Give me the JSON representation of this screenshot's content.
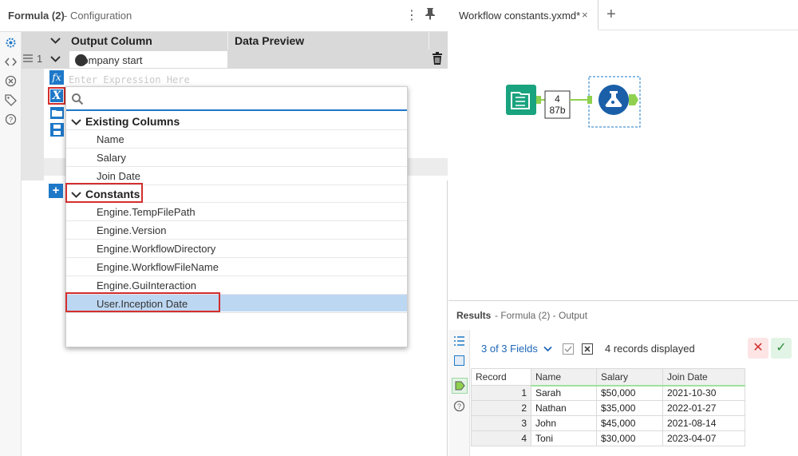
{
  "left_panel": {
    "title": "Formula (2)",
    "subtitle": "- Configuration"
  },
  "grid": {
    "col_output": "Output Column",
    "col_preview": "Data Preview",
    "row_number": "1",
    "output_value": "Company start",
    "expression_placeholder": "Enter Expression Here"
  },
  "popup": {
    "sections": [
      {
        "label": "Existing Columns",
        "items": [
          "Name",
          "Salary",
          "Join Date"
        ]
      },
      {
        "label": "Constants",
        "items": [
          "Engine.TempFilePath",
          "Engine.Version",
          "Engine.WorkflowDirectory",
          "Engine.WorkflowFileName",
          "Engine.GuiInteraction",
          "User.Inception Date"
        ]
      }
    ],
    "selected_item": "User.Inception Date"
  },
  "workflow": {
    "tab_label": "Workflow constants.yxmd*",
    "tab_close": "×",
    "new_tab": "+",
    "connector_count": "4",
    "connector_size": "87b"
  },
  "results": {
    "title": "Results",
    "subtitle": "- Formula (2) - Output",
    "fields_selector": "3 of 3 Fields",
    "records_displayed": "4 records displayed",
    "columns": [
      "Record",
      "Name",
      "Salary",
      "Join Date"
    ],
    "rows": [
      [
        "1",
        "Sarah",
        "$50,000",
        "2021-10-30"
      ],
      [
        "2",
        "Nathan",
        "$35,000",
        "2022-01-27"
      ],
      [
        "3",
        "John",
        "$45,000",
        "2021-08-14"
      ],
      [
        "4",
        "Toni",
        "$30,000",
        "2023-04-07"
      ]
    ]
  },
  "colors": {
    "accent": "#1e78c8",
    "highlight_border": "#d32f2f",
    "selected_row": "#bcd7f2",
    "tool_teal": "#1aa37f",
    "tool_blue": "#1a5fa8",
    "connector_green": "#8fd14f"
  }
}
